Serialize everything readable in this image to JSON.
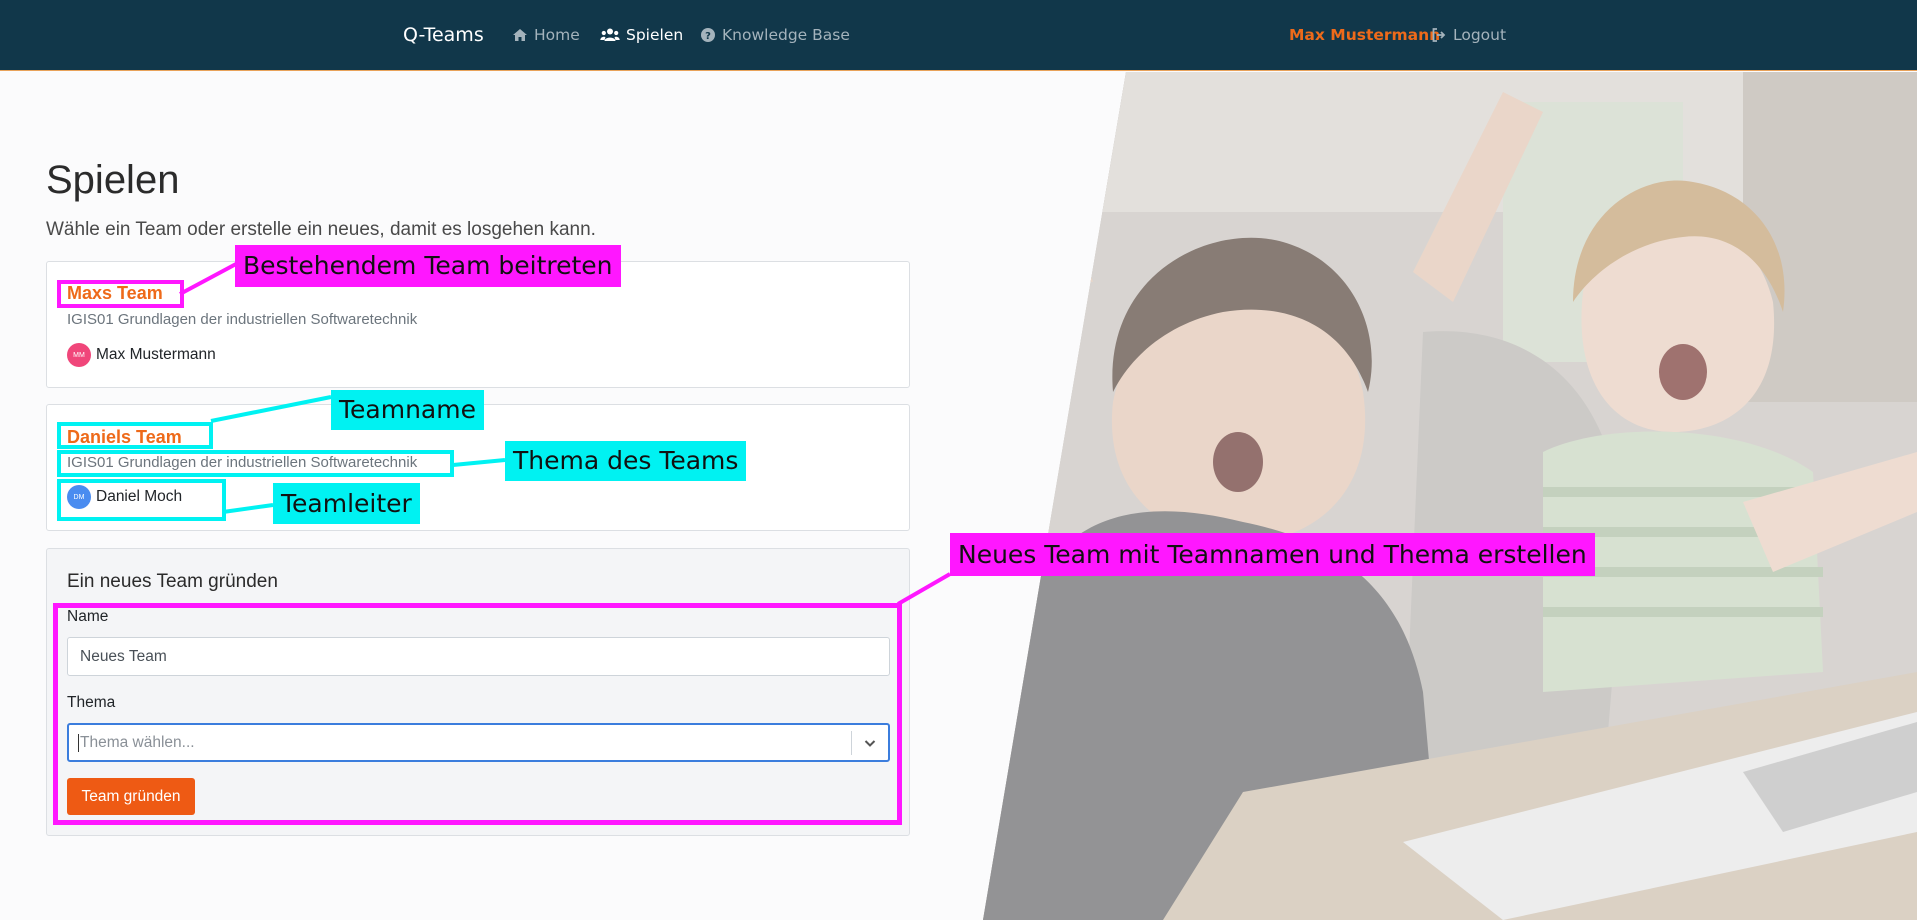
{
  "navbar": {
    "brand": "Q-Teams",
    "links": [
      {
        "label": "Home",
        "icon": "home-icon"
      },
      {
        "label": "Spielen",
        "icon": "users-icon"
      },
      {
        "label": "Knowledge Base",
        "icon": "question-circle-icon"
      }
    ],
    "user_name": "Max Mustermann",
    "logout_label": "Logout",
    "logout_icon": "sign-out-icon"
  },
  "page": {
    "title": "Spielen",
    "lead": "Wähle ein Team oder erstelle ein neues, damit es losgehen kann."
  },
  "teams": [
    {
      "name": "Maxs Team",
      "topic": "IGIS01 Grundlagen der industriellen Softwaretechnik",
      "leader": "Max Mustermann",
      "initials": "MM",
      "avatar_color": "#f0467a"
    },
    {
      "name": "Daniels Team",
      "topic": "IGIS01 Grundlagen der industriellen Softwaretechnik",
      "leader": "Daniel Moch",
      "initials": "DM",
      "avatar_color": "#4a8cf0"
    }
  ],
  "new_team": {
    "title": "Ein neues Team gründen",
    "name_label": "Name",
    "name_value": "Neues Team",
    "topic_label": "Thema",
    "topic_placeholder": "Thema wählen...",
    "submit_label": "Team gründen"
  },
  "annotations": {
    "join_existing": "Bestehendem Team beitreten",
    "team_name": "Teamname",
    "team_topic": "Thema des Teams",
    "team_leader": "Teamleiter",
    "create_new": "Neues Team mit Teamnamen und Thema erstellen"
  },
  "colors": {
    "navbar_bg": "#11374a",
    "accent_orange": "#ee6a1a",
    "annotation_magenta": "#ff17ff",
    "annotation_cyan": "#00f2f2"
  }
}
